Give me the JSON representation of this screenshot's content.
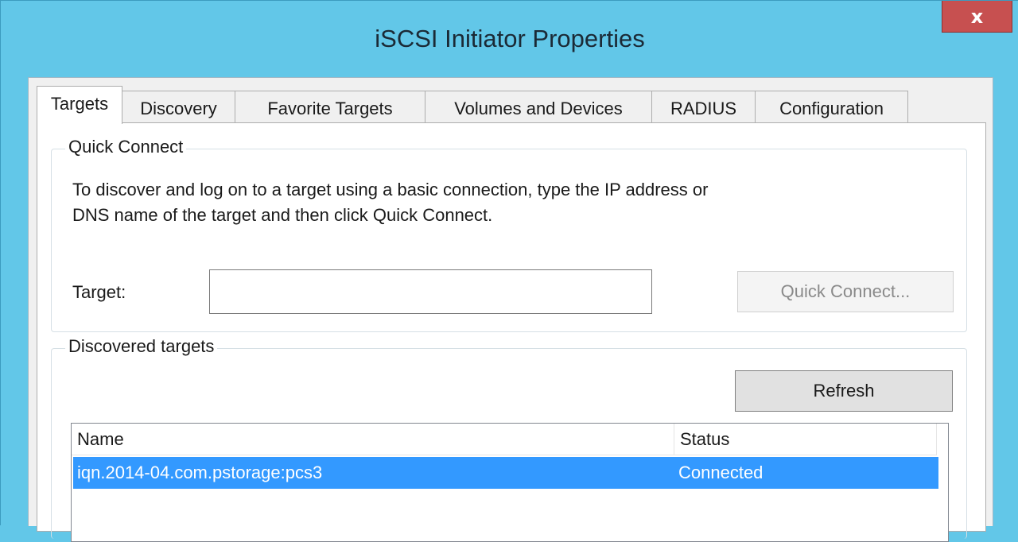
{
  "window": {
    "title": "iSCSI Initiator Properties",
    "close_label": "x"
  },
  "tabs": [
    {
      "label": "Targets",
      "active": true
    },
    {
      "label": "Discovery",
      "active": false
    },
    {
      "label": "Favorite Targets",
      "active": false
    },
    {
      "label": "Volumes and Devices",
      "active": false
    },
    {
      "label": "RADIUS",
      "active": false
    },
    {
      "label": "Configuration",
      "active": false
    }
  ],
  "quick_connect": {
    "group_title": "Quick Connect",
    "description_line1": "To discover and log on to a target using a basic connection, type the IP address or",
    "description_line2": "DNS name of the target and then click Quick Connect.",
    "target_label": "Target:",
    "target_value": "",
    "button_label": "Quick Connect..."
  },
  "discovered_targets": {
    "group_title": "Discovered targets",
    "refresh_label": "Refresh",
    "columns": [
      "Name",
      "Status"
    ],
    "rows": [
      {
        "name": "iqn.2014-04.com.pstorage:pcs3",
        "status": "Connected",
        "selected": true
      }
    ]
  },
  "colors": {
    "titlebar": "#62c7e8",
    "close_button": "#c75050",
    "selection": "#3399ff"
  }
}
